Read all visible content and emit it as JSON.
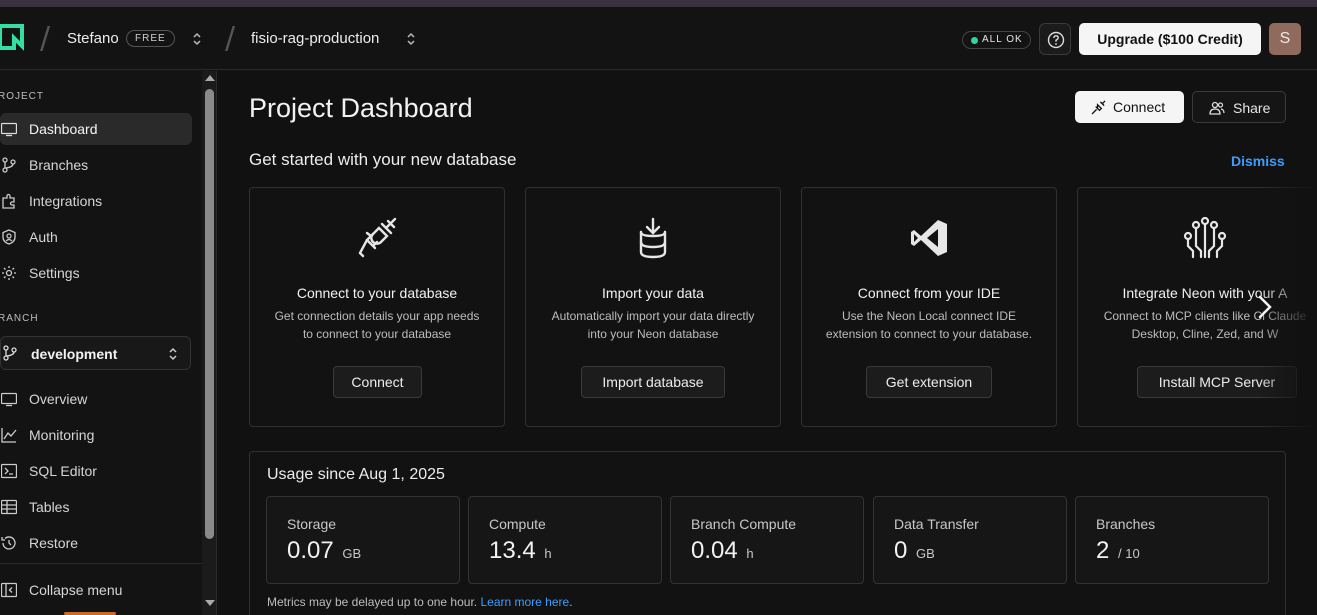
{
  "header": {
    "org_name": "Stefano",
    "plan_badge": "FREE",
    "project_name": "fisio-rag-production",
    "status_text": "ALL OK",
    "upgrade_label": "Upgrade ($100 Credit)",
    "avatar_letter": "S",
    "status_color": "#34d399"
  },
  "sidebar": {
    "project_section": "ROJECT",
    "project_items": [
      {
        "label": "Dashboard",
        "icon": "monitor-icon"
      },
      {
        "label": "Branches",
        "icon": "branch-icon"
      },
      {
        "label": "Integrations",
        "icon": "puzzle-icon"
      },
      {
        "label": "Auth",
        "icon": "shield-user-icon"
      },
      {
        "label": "Settings",
        "icon": "gear-icon"
      }
    ],
    "branch_section": "RANCH",
    "branch_selected": "development",
    "branch_items": [
      {
        "label": "Overview",
        "icon": "monitor-icon"
      },
      {
        "label": "Monitoring",
        "icon": "chart-line-icon"
      },
      {
        "label": "SQL Editor",
        "icon": "terminal-icon"
      },
      {
        "label": "Tables",
        "icon": "table-icon"
      },
      {
        "label": "Restore",
        "icon": "history-icon"
      }
    ],
    "collapse_label": "Collapse menu"
  },
  "main": {
    "page_title": "Project Dashboard",
    "connect_label": "Connect",
    "share_label": "Share",
    "getting_started_title": "Get started with your new database",
    "dismiss_label": "Dismiss",
    "cards": [
      {
        "title": "Connect to your database",
        "desc": "Get connection details your app needs to connect to your database",
        "button": "Connect",
        "icon": "plug-icon"
      },
      {
        "title": "Import your data",
        "desc": "Automatically import your data directly into your Neon database",
        "button": "Import database",
        "icon": "database-import-icon"
      },
      {
        "title": "Connect from your IDE",
        "desc": "Use the Neon Local connect IDE extension to connect to your database.",
        "button": "Get extension",
        "icon": "vscode-icon"
      },
      {
        "title": "Integrate Neon with your A",
        "desc": "Connect to MCP clients like Cl Claude Desktop, Cline, Zed, and W",
        "button": "Install MCP Server",
        "icon": "circuit-icon"
      }
    ],
    "usage": {
      "title": "Usage since Aug 1, 2025",
      "metrics": [
        {
          "label": "Storage",
          "value": "0.07",
          "unit": "GB"
        },
        {
          "label": "Compute",
          "value": "13.4",
          "unit": "h"
        },
        {
          "label": "Branch Compute",
          "value": "0.04",
          "unit": "h"
        },
        {
          "label": "Data Transfer",
          "value": "0",
          "unit": "GB"
        },
        {
          "label": "Branches",
          "value": "2",
          "unit": "/ 10"
        }
      ],
      "note_text": "Metrics may be delayed up to one hour.",
      "note_link": "Learn more here",
      "note_end": "."
    }
  }
}
